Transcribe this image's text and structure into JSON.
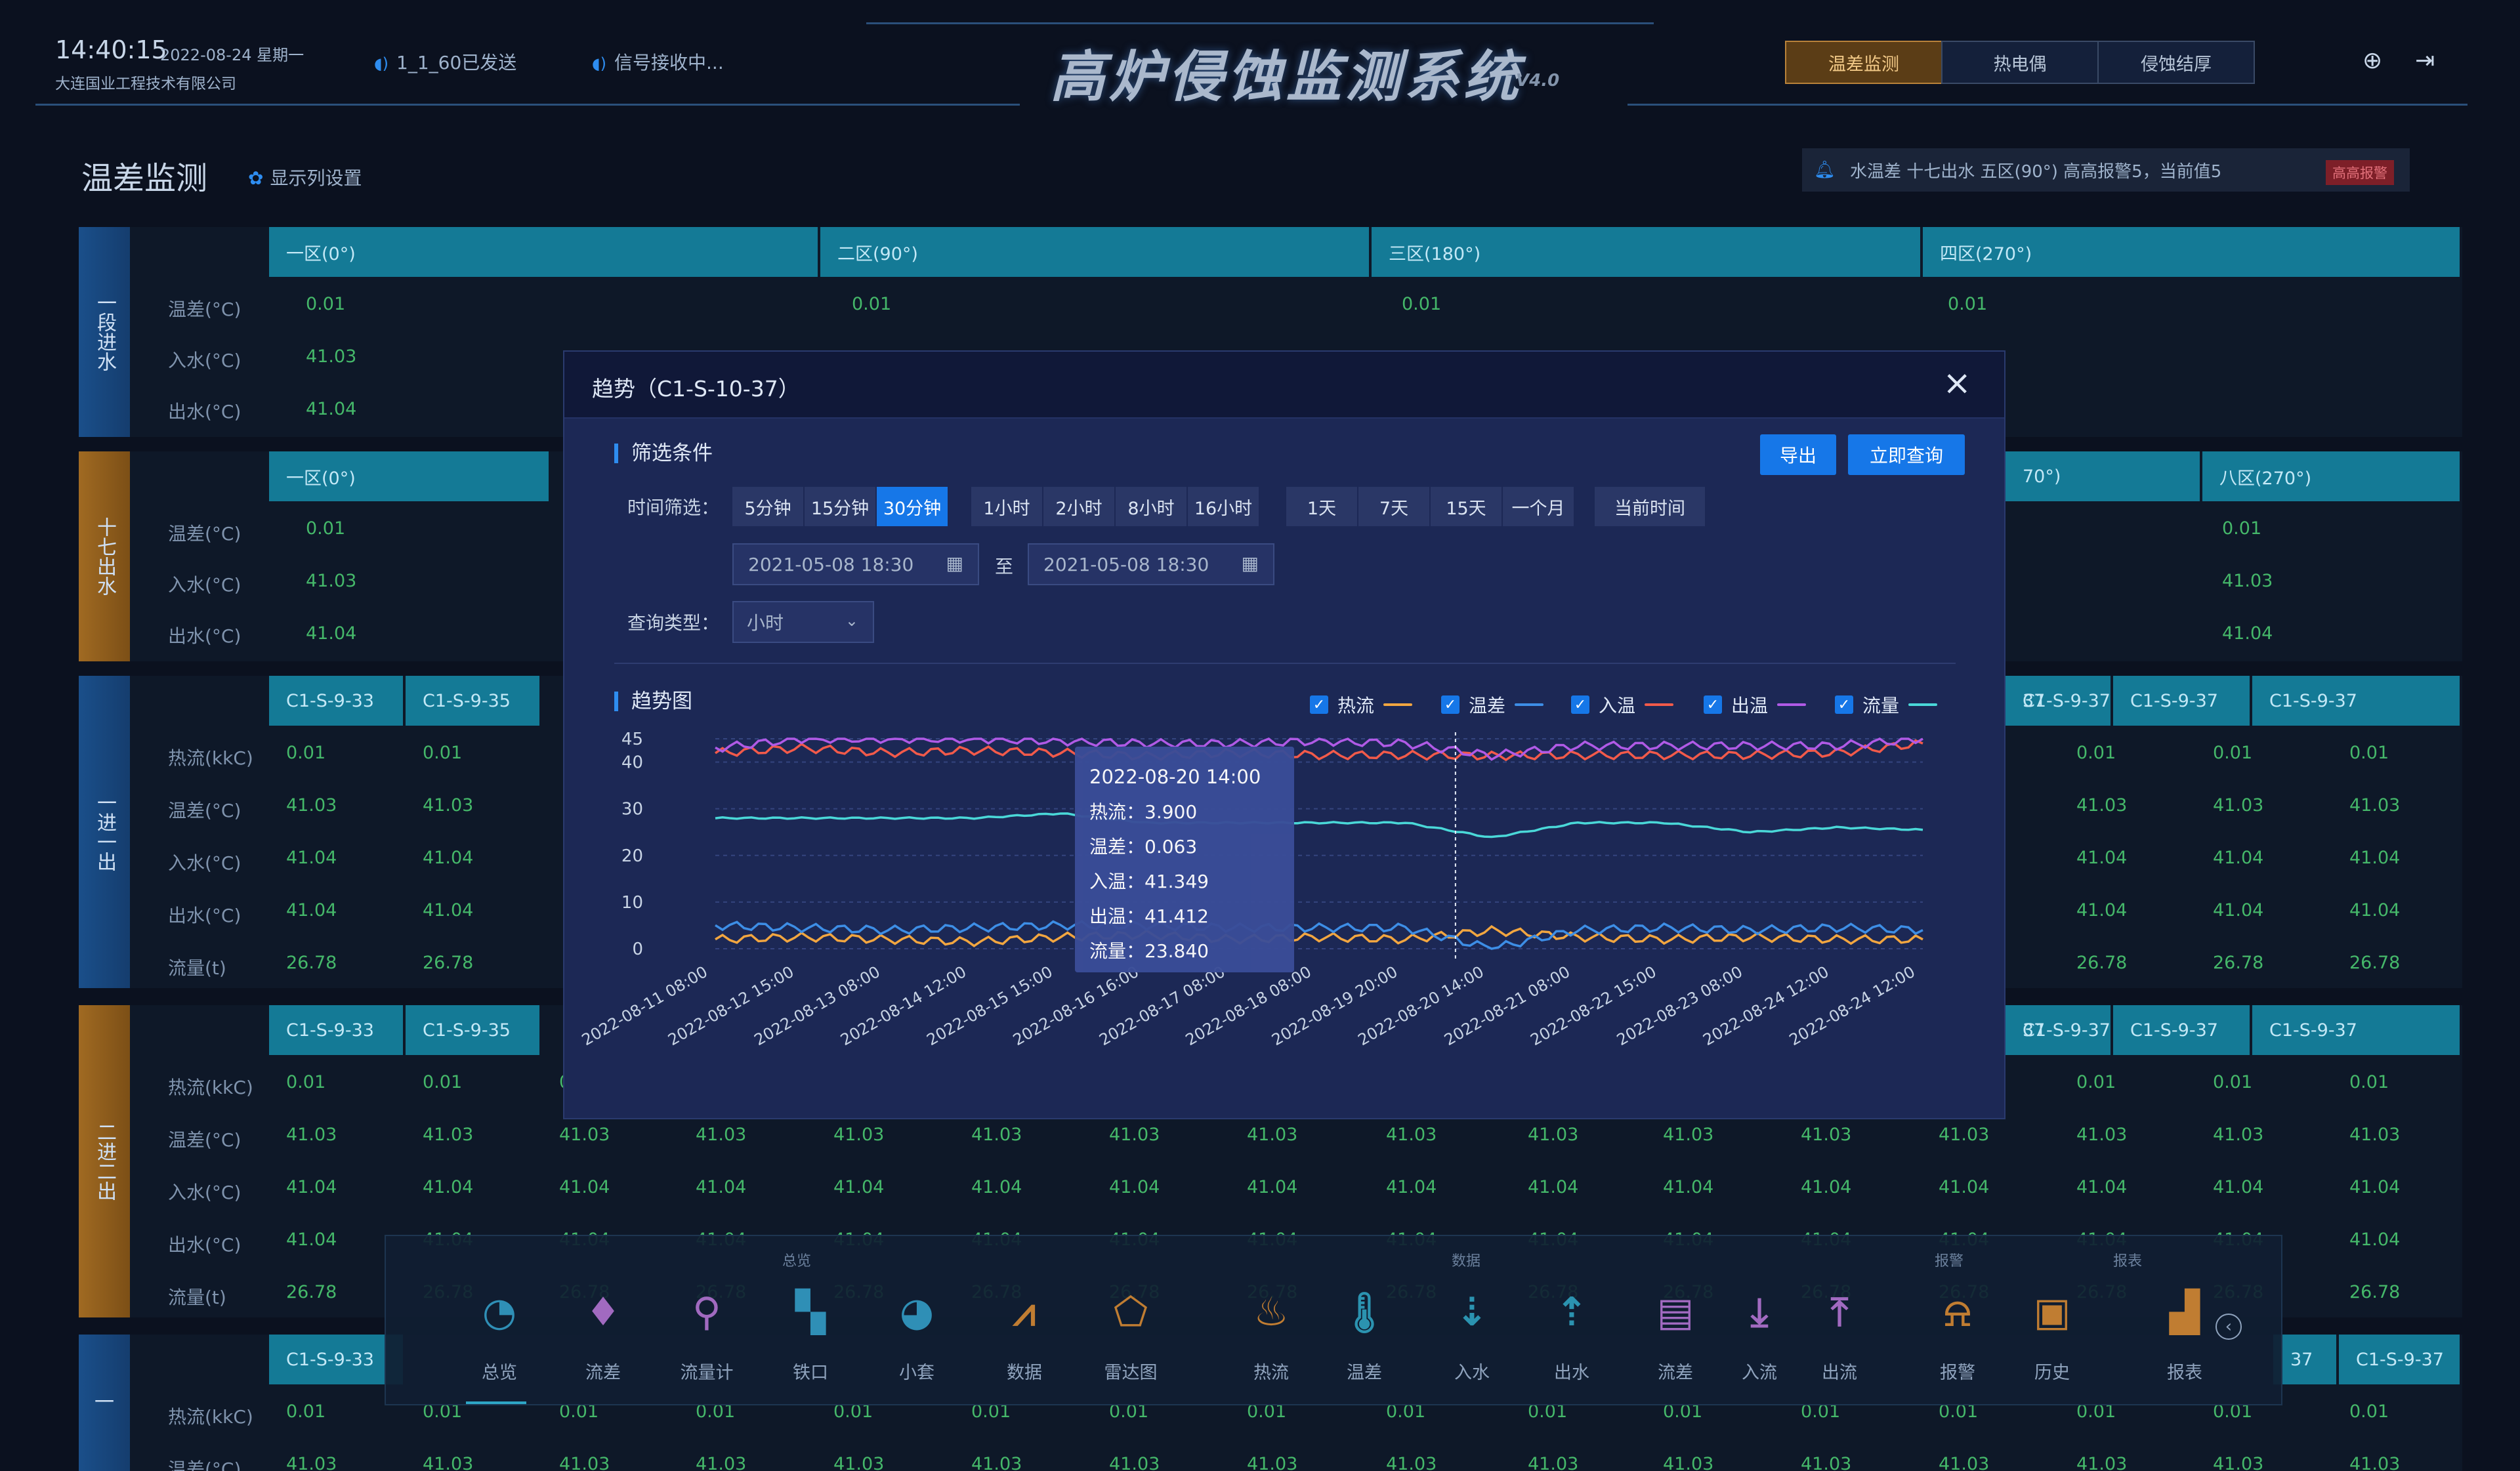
{
  "header": {
    "time": "14:40:15",
    "date": "2022-08-24 星期一",
    "company": "大连国业工程技术有限公司",
    "signal1": "1_1_60已发送",
    "signal2": "信号接收中...",
    "title": "高炉侵蚀监测系统",
    "version": "V4.0",
    "tabs": [
      "温差监测",
      "热电偶",
      "侵蚀结厚"
    ],
    "active_tab": "温差监测",
    "icons": [
      "globe-icon",
      "logout-icon"
    ]
  },
  "page": {
    "title": "温差监测",
    "column_settings": "显示列设置",
    "alarm_text": "水温差 十七出水 五区(90°) 高高报警5，当前值5",
    "alarm_tag": "高高报警"
  },
  "sections": [
    {
      "label": "一段进水",
      "color": "blue",
      "rows": [
        "温差(°C)",
        "入水(°C)",
        "出水(°C)"
      ],
      "headers": [
        "一区(0°)",
        "二区(90°)",
        "三区(180°)",
        "四区(270°)"
      ],
      "values": [
        [
          "0.01",
          "0.01",
          "0.01",
          "0.01"
        ],
        [
          "41.03"
        ],
        [
          "41.04"
        ]
      ]
    },
    {
      "label": "十七出水",
      "color": "gold",
      "rows": [
        "温差(°C)",
        "入水(°C)",
        "出水(°C)"
      ],
      "headers": [
        "一区(0°)",
        "70°)",
        "八区(270°)"
      ],
      "values": [
        [
          "0.01",
          "0.01"
        ],
        [
          "41.03",
          "41.03"
        ],
        [
          "41.04",
          "41.04"
        ]
      ]
    },
    {
      "label": "一进一出",
      "color": "blue",
      "rows": [
        "热流(kkC)",
        "温差(°C)",
        "入水(°C)",
        "出水(°C)",
        "流量(t)"
      ],
      "headers": [
        "C1-S-9-33",
        "C1-S-9-35",
        "37",
        "C1-S-9-37",
        "C1-S-9-37",
        "C1-S-9-37"
      ],
      "row_values": [
        "0.01",
        "41.03",
        "41.04",
        "41.04",
        "26.78"
      ]
    },
    {
      "label": "二进二出",
      "color": "gold",
      "rows": [
        "热流(kkC)",
        "温差(°C)",
        "入水(°C)",
        "出水(°C)",
        "流量(t)"
      ],
      "headers": [
        "C1-S-9-33",
        "C1-S-9-35",
        "37",
        "C1-S-9-37",
        "C1-S-9-37",
        "C1-S-9-37"
      ],
      "row_values": [
        "0.01",
        "41.03",
        "41.04",
        "41.04",
        "26.78"
      ]
    },
    {
      "label": "一",
      "color": "blue",
      "rows": [
        "热流(kkC)",
        "温差(°C)"
      ],
      "headers": [
        "C1-S-9-33",
        "37",
        "C1-S-9-37"
      ],
      "row_values": [
        "0.01",
        "41.03"
      ],
      "alert_value": "41.03"
    }
  ],
  "modal": {
    "title": "趋势（C1-S-10-37）",
    "filter_title": "筛选条件",
    "export": "导出",
    "query": "立即查询",
    "time_filter_label": "时间筛选：",
    "minutes": [
      "5分钟",
      "15分钟",
      "30分钟"
    ],
    "active_minute": "30分钟",
    "hours": [
      "1小时",
      "2小时",
      "8小时",
      "16小时"
    ],
    "days": [
      "1天",
      "7天",
      "15天",
      "一个月"
    ],
    "now": "当前时间",
    "start": "2021-05-08 18:30",
    "end": "2021-05-08 18:30",
    "to": "至",
    "query_type_label": "查询类型：",
    "query_type": "小时",
    "trend_title": "趋势图",
    "tooltip": {
      "time": "2022-08-20  14:00",
      "lines": [
        "热流：3.900",
        "温差：0.063",
        "入温：41.349",
        "出温：41.412",
        "流量：23.840"
      ]
    }
  },
  "chart_data": {
    "type": "line",
    "x": [
      "2022-08-11 08:00",
      "2022-08-12 15:00",
      "2022-08-13 08:00",
      "2022-08-14 12:00",
      "2022-08-15 15:00",
      "2022-08-16 16:00",
      "2022-08-17 08:00",
      "2022-08-18 08:00",
      "2022-08-19 20:00",
      "2022-08-20 14:00",
      "2022-08-21 08:00",
      "2022-08-22 15:00",
      "2022-08-23 08:00",
      "2022-08-24 12:00",
      "2022-08-24 12:00"
    ],
    "ylim": [
      0,
      45
    ],
    "yticks": [
      0,
      10,
      20,
      30,
      40,
      45
    ],
    "series": [
      {
        "name": "热流",
        "color": "#f2a640",
        "values": [
          2,
          2.5,
          2,
          1.5,
          2.5,
          3,
          2,
          2.5,
          2,
          3.9,
          2.5,
          2,
          2.5,
          2,
          2
        ]
      },
      {
        "name": "温差",
        "color": "#3d8ee6",
        "values": [
          5,
          4.5,
          4,
          4.5,
          5,
          5,
          4.5,
          4.5,
          4.5,
          0.063,
          4,
          4.5,
          4,
          4.5,
          4
        ]
      },
      {
        "name": "入温",
        "color": "#f25a4a",
        "values": [
          42,
          43,
          42,
          42.5,
          42,
          41.3,
          42,
          41.5,
          41.5,
          41.349,
          41.5,
          41.5,
          41.5,
          42,
          44
        ]
      },
      {
        "name": "出温",
        "color": "#b05ae6",
        "values": [
          43,
          45,
          45,
          45,
          44.5,
          44,
          44,
          44.5,
          44,
          41.412,
          43.5,
          43.5,
          43.5,
          43.5,
          45
        ]
      },
      {
        "name": "流量",
        "color": "#4ad8d8",
        "values": [
          28,
          28,
          28,
          28,
          29,
          27,
          27,
          27,
          27,
          23.84,
          27,
          27,
          25,
          26,
          25.5
        ]
      }
    ],
    "grid": true
  },
  "dock": {
    "groups": [
      "总览",
      "数据",
      "报警",
      "报表"
    ],
    "items": [
      {
        "label": "总览",
        "icon": "pie-chart-icon",
        "tone": "blue"
      },
      {
        "label": "流差",
        "icon": "drop-icon",
        "tone": "purple"
      },
      {
        "label": "流量计",
        "icon": "flowmeter-icon",
        "tone": "purple"
      },
      {
        "label": "铁口",
        "icon": "tap-hole-icon",
        "tone": "blue"
      },
      {
        "label": "小套",
        "icon": "tuyere-icon",
        "tone": "blue"
      },
      {
        "label": "数据",
        "icon": "line-chart-icon",
        "tone": "orange"
      },
      {
        "label": "雷达图",
        "icon": "radar-icon",
        "tone": "orange"
      },
      {
        "label": "热流",
        "icon": "flame-icon",
        "tone": "orange"
      },
      {
        "label": "温差",
        "icon": "thermometer-icon",
        "tone": "teal"
      },
      {
        "label": "入水",
        "icon": "water-in-icon",
        "tone": "teal"
      },
      {
        "label": "出水",
        "icon": "water-out-icon",
        "tone": "teal"
      },
      {
        "label": "流差",
        "icon": "clipboard-icon",
        "tone": "purple"
      },
      {
        "label": "入流",
        "icon": "download-icon",
        "tone": "purple"
      },
      {
        "label": "出流",
        "icon": "upload-icon",
        "tone": "purple"
      },
      {
        "label": "报警",
        "icon": "alarm-light-icon",
        "tone": "orange"
      },
      {
        "label": "历史",
        "icon": "history-icon",
        "tone": "orange"
      },
      {
        "label": "报表",
        "icon": "report-icon",
        "tone": "orange"
      }
    ]
  }
}
